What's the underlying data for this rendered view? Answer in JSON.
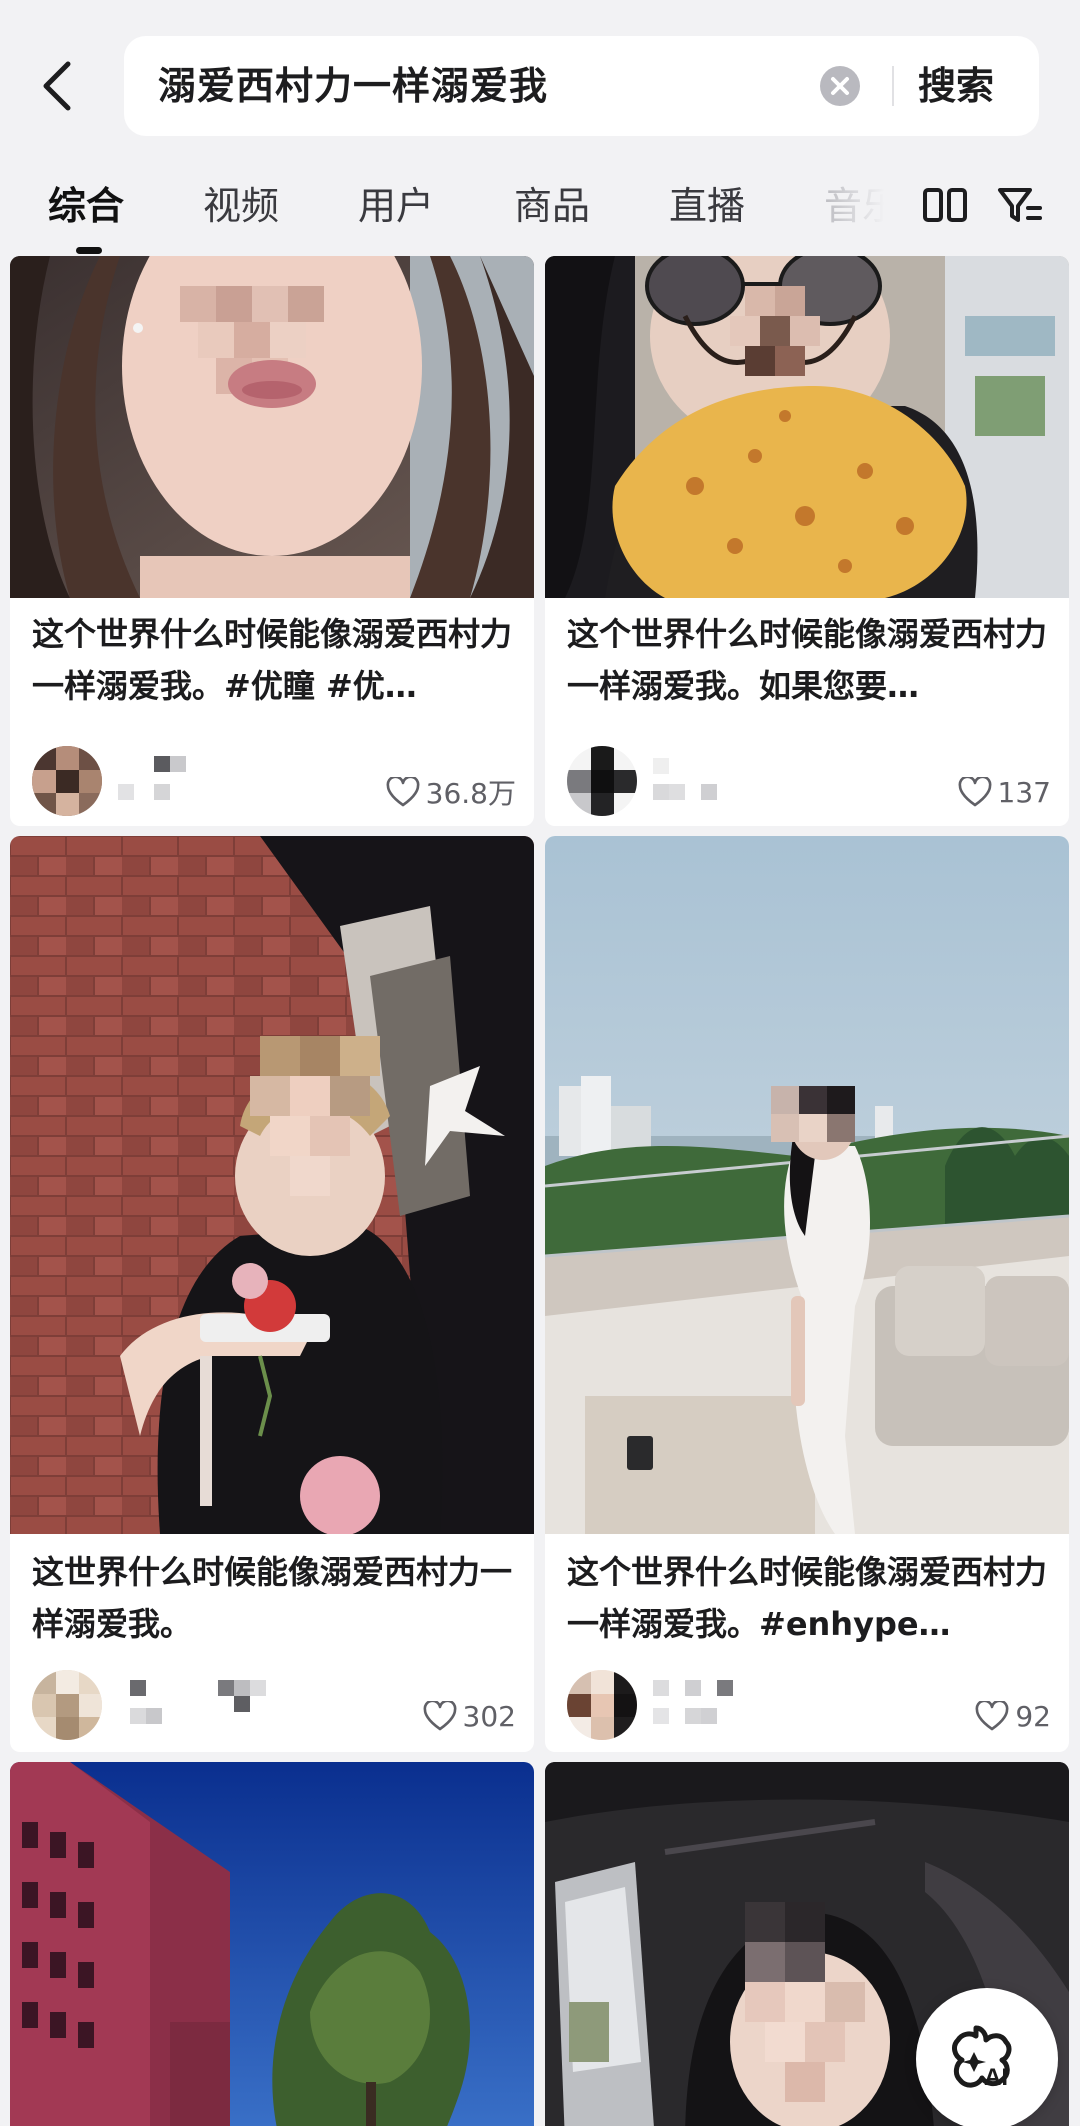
{
  "search": {
    "query": "溺爱西村力一样溺爱我",
    "button_label": "搜索"
  },
  "tabs": [
    {
      "label": "综合",
      "active": true
    },
    {
      "label": "视频",
      "active": false
    },
    {
      "label": "用户",
      "active": false
    },
    {
      "label": "商品",
      "active": false
    },
    {
      "label": "直播",
      "active": false
    },
    {
      "label": "音乐",
      "active": false
    }
  ],
  "cards": [
    {
      "title": "这个世界什么时候能像溺爱西村力一样溺爱我。#优瞳 #优…",
      "likes": "36.8万"
    },
    {
      "title": "这个世界什么时候能像溺爱西村力一样溺爱我。如果您要…",
      "likes": "137"
    },
    {
      "title": "这世界什么时候能像溺爱西村力一样溺爱我。",
      "likes": "302"
    },
    {
      "title": "这个世界什么时候能像溺爱西村力一样溺爱我。#enhype…",
      "likes": "92"
    }
  ],
  "fab": {
    "label": "AI"
  },
  "colors": {
    "background": "#f2f2f4",
    "card": "#ffffff",
    "text": "#1c1c1e",
    "muted": "#606066"
  },
  "icons": [
    "back-arrow-icon",
    "clear-icon",
    "layout-toggle-icon",
    "filter-icon",
    "heart-icon",
    "ai-sparkle-icon"
  ]
}
